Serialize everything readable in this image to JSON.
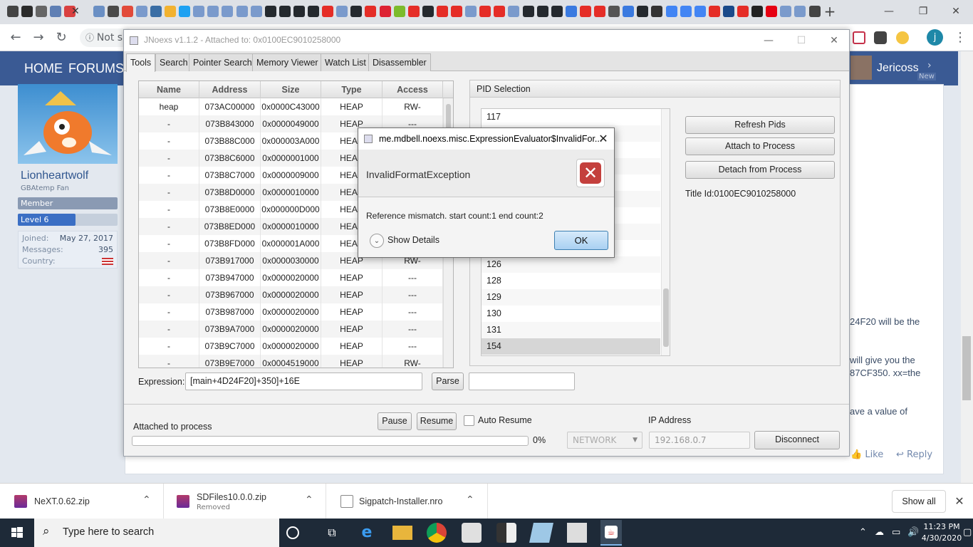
{
  "browser": {
    "omnibox_text": "Not s",
    "profile_initial": "j",
    "new_tab": "+",
    "win_min": "—",
    "win_max": "❐",
    "win_close": "✕"
  },
  "site": {
    "nav": {
      "home": "HOME",
      "forums": "FORUMS"
    },
    "username": "Jericoss",
    "new_badge": "New",
    "profile": {
      "name": "Lionheartwolf",
      "title": "GBAtemp Fan",
      "member_label": "Member",
      "level_label": "Level 6",
      "level_progress": 0.58,
      "stats": [
        {
          "label": "Joined:",
          "value": "May 27, 2017"
        },
        {
          "label": "Messages:",
          "value": "395"
        },
        {
          "label": "Country:",
          "value": ""
        }
      ]
    },
    "post_fragments": {
      "frag1": "24F20 will be the",
      "frag2": "will give you the",
      "frag3": "87CF350. xx=the",
      "frag4": "ave a value of"
    },
    "post_actions": {
      "like": "Like",
      "reply": "Reply"
    }
  },
  "app": {
    "title": "JNoexs v1.1.2 - Attached to: 0x0100EC9010258000",
    "tabs": [
      "Tools",
      "Search",
      "Pointer Search",
      "Memory Viewer",
      "Watch List",
      "Disassembler"
    ],
    "active_tab": "Tools",
    "table": {
      "columns": [
        "Name",
        "Address",
        "Size",
        "Type",
        "Access"
      ],
      "rows": [
        [
          "heap",
          "073AC00000",
          "0x0000C43000",
          "HEAP",
          "RW-"
        ],
        [
          "-",
          "073B843000",
          "0x0000049000",
          "HEAP",
          "---"
        ],
        [
          "-",
          "073B88C000",
          "0x000003A000",
          "HEAP",
          "---"
        ],
        [
          "-",
          "073B8C6000",
          "0x0000001000",
          "HEAP",
          "---"
        ],
        [
          "-",
          "073B8C7000",
          "0x0000009000",
          "HEAP",
          "---"
        ],
        [
          "-",
          "073B8D0000",
          "0x0000010000",
          "HEAP",
          "---"
        ],
        [
          "-",
          "073B8E0000",
          "0x000000D000",
          "HEAP",
          "---"
        ],
        [
          "-",
          "073B8ED000",
          "0x0000010000",
          "HEAP",
          "---"
        ],
        [
          "-",
          "073B8FD000",
          "0x000001A000",
          "HEAP",
          "---"
        ],
        [
          "-",
          "073B917000",
          "0x0000030000",
          "HEAP",
          "RW-"
        ],
        [
          "-",
          "073B947000",
          "0x0000020000",
          "HEAP",
          "---"
        ],
        [
          "-",
          "073B967000",
          "0x0000020000",
          "HEAP",
          "---"
        ],
        [
          "-",
          "073B987000",
          "0x0000020000",
          "HEAP",
          "---"
        ],
        [
          "-",
          "073B9A7000",
          "0x0000020000",
          "HEAP",
          "---"
        ],
        [
          "-",
          "073B9C7000",
          "0x0000020000",
          "HEAP",
          "---"
        ],
        [
          "-",
          "073B9E7000",
          "0x0004519000",
          "HEAP",
          "RW-"
        ]
      ]
    },
    "expression": {
      "label": "Expression:",
      "value": "[main+4D24F20]+350]+16E",
      "parse_button": "Parse",
      "result_value": ""
    },
    "pid_panel": {
      "title": "PID Selection",
      "pids": [
        "117",
        "",
        "",
        "",
        "",
        "",
        "",
        "",
        "",
        "126",
        "128",
        "129",
        "130",
        "131",
        "154"
      ],
      "selected_pid": "154",
      "refresh_button": "Refresh Pids",
      "attach_button": "Attach to Process",
      "detach_button": "Detach from Process",
      "title_id": "Title Id:0100EC9010258000"
    },
    "status": {
      "pause_button": "Pause",
      "resume_button": "Resume",
      "auto_resume_label": "Auto Resume",
      "ip_label": "IP Address",
      "status_text": "Attached to process",
      "progress_value": 0,
      "progress_text": "0%",
      "network_option": "NETWORK",
      "ip_value": "192.168.0.7",
      "disconnect_button": "Disconnect"
    }
  },
  "dialog": {
    "title": "me.mdbell.noexs.misc.ExpressionEvaluator$InvalidFor...",
    "header": "InvalidFormatException",
    "message": "Reference mismatch. start count:1 end count:2",
    "details_label": "Show Details",
    "ok_button": "OK"
  },
  "downloads": {
    "items": [
      {
        "name": "NeXT.0.62.zip",
        "sub": ""
      },
      {
        "name": "SDFiles10.0.0.zip",
        "sub": "Removed"
      },
      {
        "name": "Sigpatch-Installer.nro",
        "sub": ""
      }
    ],
    "show_all": "Show all"
  },
  "taskbar": {
    "search_placeholder": "Type here to search",
    "time": "11:23 PM",
    "date": "4/30/2020"
  }
}
